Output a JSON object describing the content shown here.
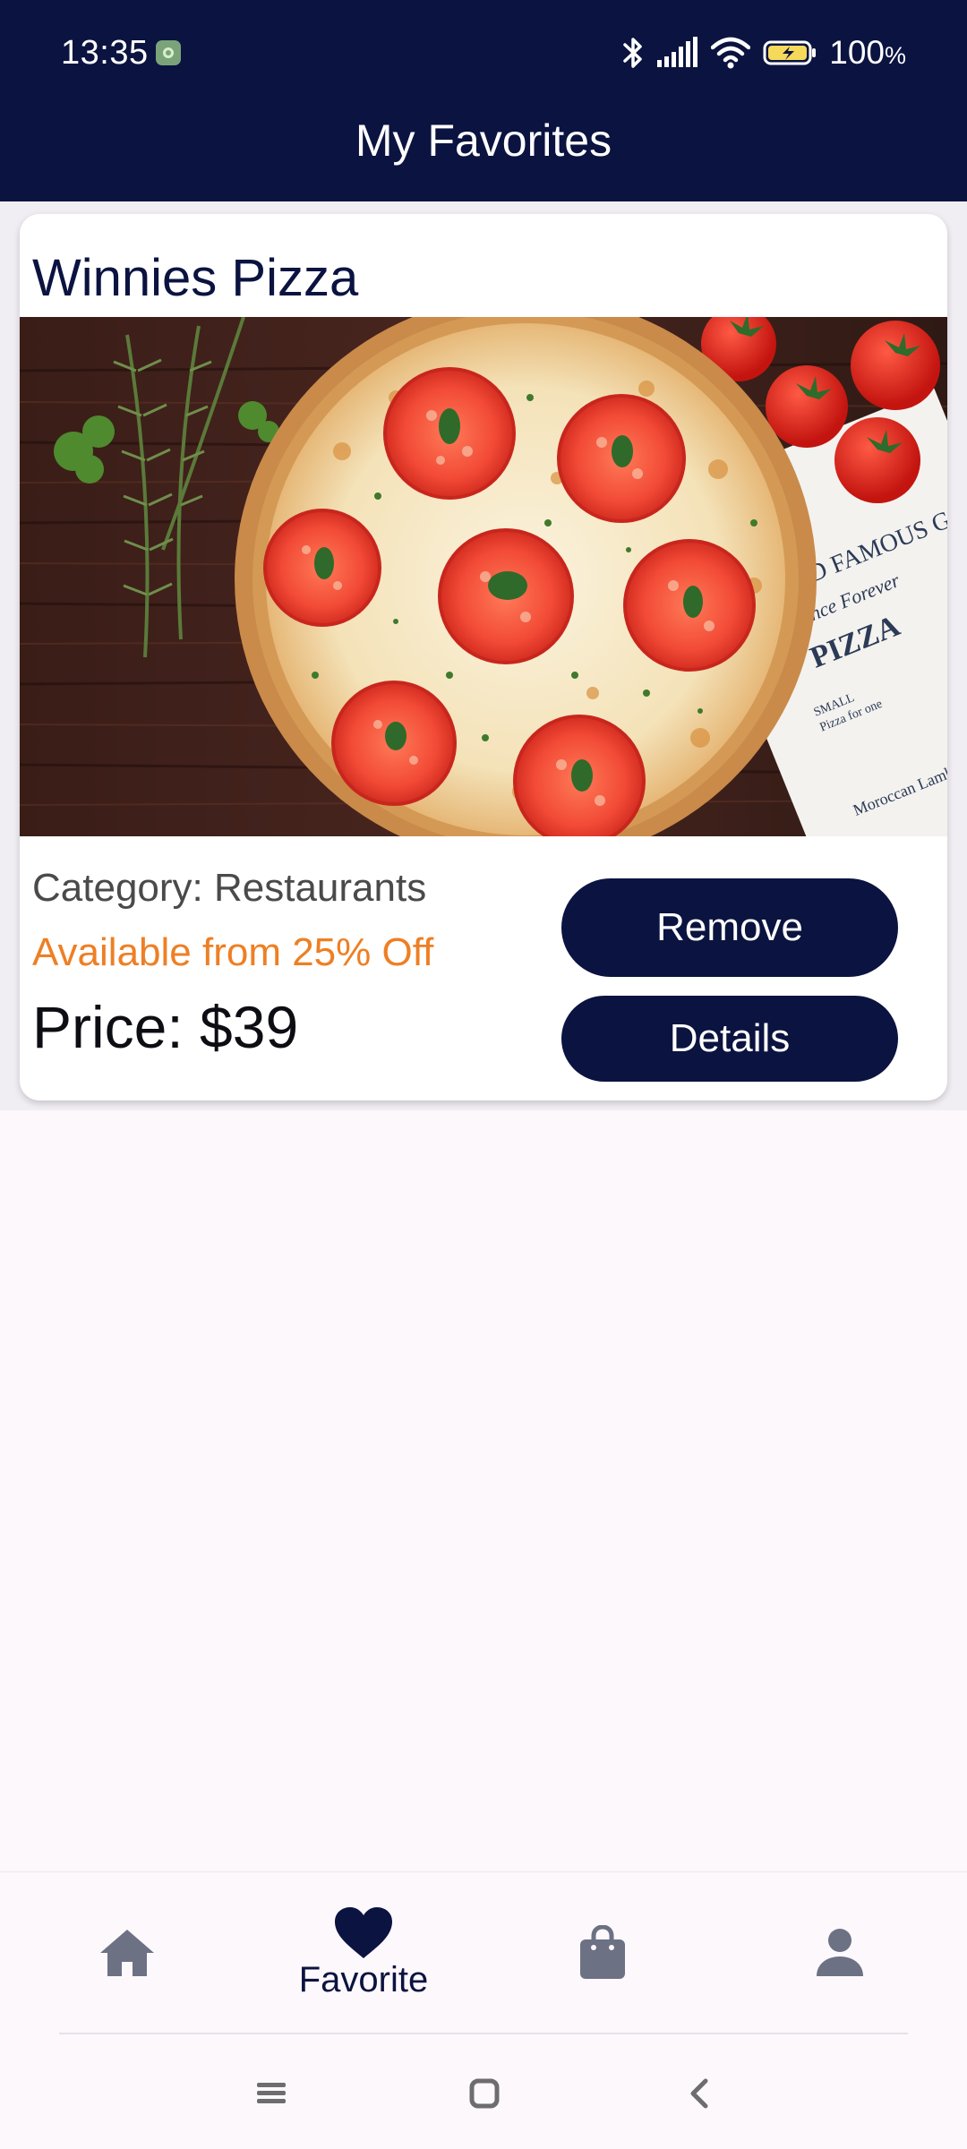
{
  "status_bar": {
    "time": "13:35",
    "battery_percent": "100",
    "battery_unit": "%"
  },
  "header": {
    "title": "My Favorites"
  },
  "favorites": [
    {
      "title": "Winnies Pizza",
      "category": "Category: Restaurants",
      "discount": "Available from 25% Off",
      "price": "Price: $39",
      "remove_label": "Remove",
      "details_label": "Details"
    }
  ],
  "bottom_nav": {
    "items": [
      {
        "icon": "home-icon"
      },
      {
        "icon": "heart-icon",
        "label": "Favorite"
      },
      {
        "icon": "shopping-bag-icon"
      },
      {
        "icon": "person-icon"
      }
    ],
    "active_index": 1
  },
  "colors": {
    "primary": "#0b1340",
    "accent": "#ee7f24",
    "inactive_icon": "#6d7184"
  }
}
